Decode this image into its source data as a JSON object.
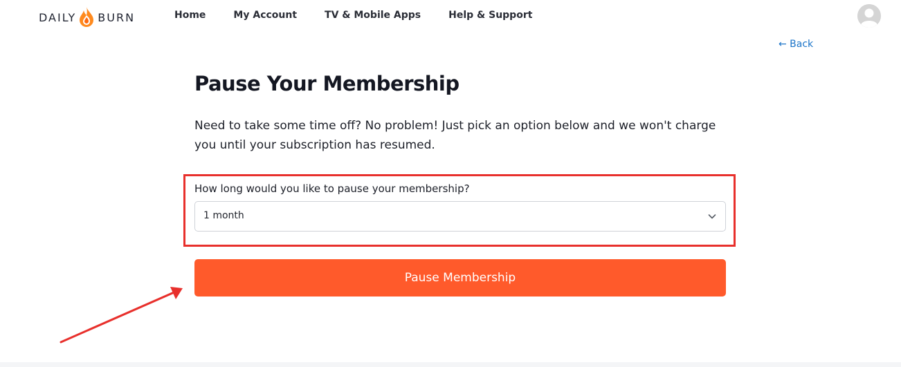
{
  "header": {
    "logo_left": "DAILY",
    "logo_right": "BURN",
    "nav": [
      {
        "label": "Home"
      },
      {
        "label": "My Account"
      },
      {
        "label": "TV & Mobile Apps"
      },
      {
        "label": "Help & Support"
      }
    ],
    "avatar_icon": "user-avatar-icon"
  },
  "back": {
    "label": "← Back"
  },
  "main": {
    "title": "Pause Your Membership",
    "description": "Need to take some time off? No problem! Just pick an option below and we won't charge you until your subscription has resumed.",
    "pause_field": {
      "label": "How long would you like to pause your membership?",
      "selected": "1 month"
    },
    "submit_label": "Pause Membership"
  },
  "colors": {
    "accent": "#ff5a2b",
    "link": "#1a73c8",
    "annotation": "#e8302c"
  }
}
